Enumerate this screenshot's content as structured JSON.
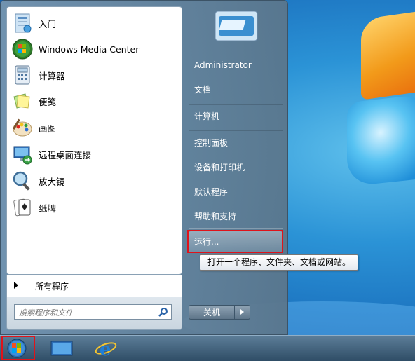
{
  "left_pane": {
    "programs": [
      {
        "label": "入门",
        "icon": "getting-started-icon"
      },
      {
        "label": "Windows Media Center",
        "icon": "media-center-icon"
      },
      {
        "label": "计算器",
        "icon": "calculator-icon"
      },
      {
        "label": "便笺",
        "icon": "sticky-notes-icon"
      },
      {
        "label": "画图",
        "icon": "paint-icon"
      },
      {
        "label": "远程桌面连接",
        "icon": "remote-desktop-icon"
      },
      {
        "label": "放大镜",
        "icon": "magnifier-icon"
      },
      {
        "label": "纸牌",
        "icon": "solitaire-icon"
      }
    ],
    "all_programs": "所有程序",
    "search_placeholder": "搜索程序和文件"
  },
  "right_pane": {
    "items": [
      {
        "label": "Administrator"
      },
      {
        "label": "文档"
      },
      {
        "label": "计算机"
      },
      {
        "label": "控制面板"
      },
      {
        "label": "设备和打印机"
      },
      {
        "label": "默认程序"
      },
      {
        "label": "帮助和支持"
      },
      {
        "label": "运行..."
      }
    ],
    "shutdown_label": "关机"
  },
  "tooltip": "打开一个程序、文件夹、文档或网站。",
  "colors": {
    "highlight_border": "#e0131a",
    "menu_bg": "#6f8aa1",
    "desktop_bg": "#2b93d6"
  }
}
